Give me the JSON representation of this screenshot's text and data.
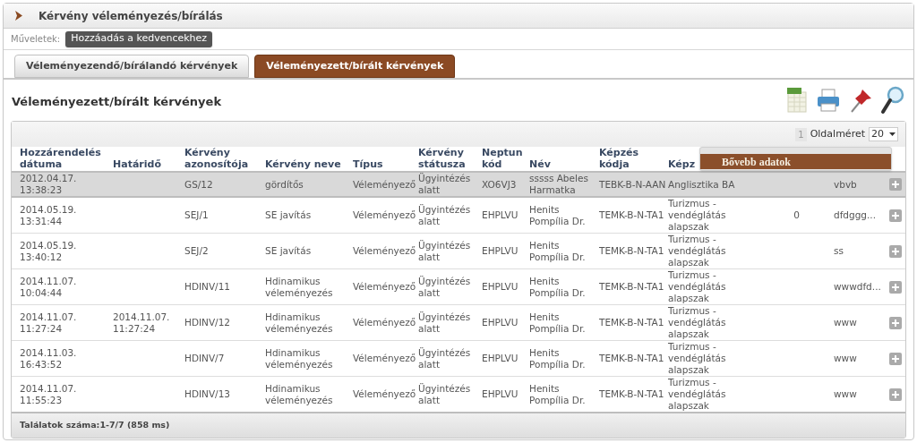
{
  "page": {
    "title": "Kérvény véleményezés/bírálás"
  },
  "actions": {
    "label": "Műveletek:",
    "buttons": [
      "Hozzáadás a kedvencekhez"
    ]
  },
  "tabs": [
    {
      "label": "Véleményezendő/bírálandó kérvények",
      "selected": false
    },
    {
      "label": "Véleményezett/bírált kérvények",
      "selected": true
    }
  ],
  "section_title": "Véleményezett/bírált kérvények",
  "grid": {
    "pager": {
      "page": "1",
      "label": "Oldalméret",
      "page_size": "20"
    },
    "columns": [
      "Hozzárendelés dátuma",
      "Határidő",
      "Kérvény azonosítója",
      "Kérvény neve",
      "Típus",
      "Kérvény státusza",
      "Neptun kód",
      "Név",
      "Képzés kódja",
      "Képz"
    ],
    "rows": [
      {
        "selected": true,
        "date": "2012.04.17. 13:38:23",
        "id": "GS/12",
        "name": "gördítős",
        "type": "Véleményező",
        "status": "Ügyintézés alatt",
        "neptun": "XO6VJ3",
        "person": "sssss Abeles Harmatka",
        "program_code": "TEBK-B-N-AAN",
        "program": "Anglisztika BA",
        "column_12": "vbvb"
      },
      {
        "selected": false,
        "date": "2014.05.19. 13:31:44",
        "id": "SEJ/1",
        "name": "SE javítás",
        "type": "Véleményező",
        "status": "Ügyintézés alatt",
        "neptun": "EHPLVU",
        "person": "Henits Pompília Dr.",
        "program_code": "TEMK-B-N-TA1",
        "program": "Turizmus - vendéglátás alapszak",
        "column_11": "0",
        "column_12": "dfdggg..."
      },
      {
        "selected": false,
        "date": "2014.05.19. 13:40:12",
        "id": "SEJ/2",
        "name": "SE javítás",
        "type": "Véleményező",
        "status": "Ügyintézés alatt",
        "neptun": "EHPLVU",
        "person": "Henits Pompília Dr.",
        "program_code": "TEMK-B-N-TA1",
        "program": "Turizmus - vendéglátás alapszak",
        "column_12": "ss"
      },
      {
        "selected": false,
        "date": "2014.11.07. 10:04:44",
        "id": "HDINV/11",
        "name": "Hdinamikus véleményezés",
        "type": "Véleményező",
        "status": "Ügyintézés alatt",
        "neptun": "EHPLVU",
        "person": "Henits Pompília Dr.",
        "program_code": "TEMK-B-N-TA1",
        "program": "Turizmus - vendéglátás alapszak",
        "column_12": "wwwdfd..."
      },
      {
        "selected": false,
        "date": "2014.11.07. 11:27:24",
        "deadline": "2014.11.07. 11:27:24",
        "id": "HDINV/12",
        "name": "Hdinamikus véleményezés",
        "type": "Véleményező",
        "status": "Ügyintézés alatt",
        "neptun": "EHPLVU",
        "person": "Henits Pompília Dr.",
        "program_code": "TEMK-B-N-TA1",
        "program": "Turizmus - vendéglátás alapszak",
        "column_12": "www"
      },
      {
        "selected": false,
        "date": "2014.11.03. 16:43:52",
        "id": "HDINV/7",
        "name": "Hdinamikus véleményezés",
        "type": "Véleményező",
        "status": "Ügyintézés alatt",
        "neptun": "EHPLVU",
        "person": "Henits Pompília Dr.",
        "program_code": "TEMK-B-N-TA1",
        "program": "Turizmus - vendéglátás alapszak",
        "column_12": "www"
      },
      {
        "selected": false,
        "date": "2014.11.07. 11:55:23",
        "id": "HDINV/13",
        "name": "Hdinamikus véleményezés",
        "type": "Véleményező",
        "status": "Ügyintézés alatt",
        "neptun": "EHPLVU",
        "person": "Henits Pompília Dr.",
        "program_code": "TEMK-B-N-TA1",
        "program": "Turizmus - vendéglátás alapszak",
        "column_12": "www"
      }
    ],
    "footer": "Találatok száma:1-7/7 (858 ms)"
  },
  "popup": {
    "label": "Bővebb adatok"
  }
}
